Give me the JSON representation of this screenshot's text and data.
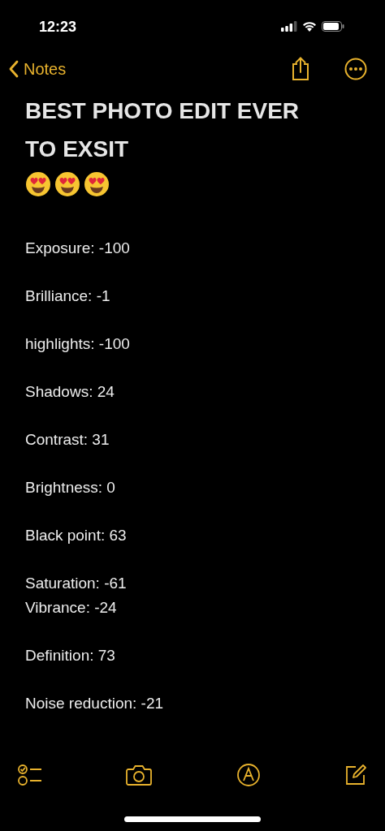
{
  "status_bar": {
    "time": "12:23"
  },
  "nav": {
    "back_label": "Notes"
  },
  "note": {
    "title": "BEST PHOTO EDIT EVER TO EXSIT",
    "paragraphs": [
      [
        "Exposure: -100"
      ],
      [
        "Brilliance: -1"
      ],
      [
        "highlights: -100"
      ],
      [
        "Shadows: 24"
      ],
      [
        "Contrast: 31"
      ],
      [
        "Brightness: 0"
      ],
      [
        "Black point: 63"
      ],
      [
        "Saturation: -61",
        "Vibrance: -24"
      ],
      [
        "Definition: 73"
      ],
      [
        "Noise reduction: -21"
      ]
    ]
  }
}
